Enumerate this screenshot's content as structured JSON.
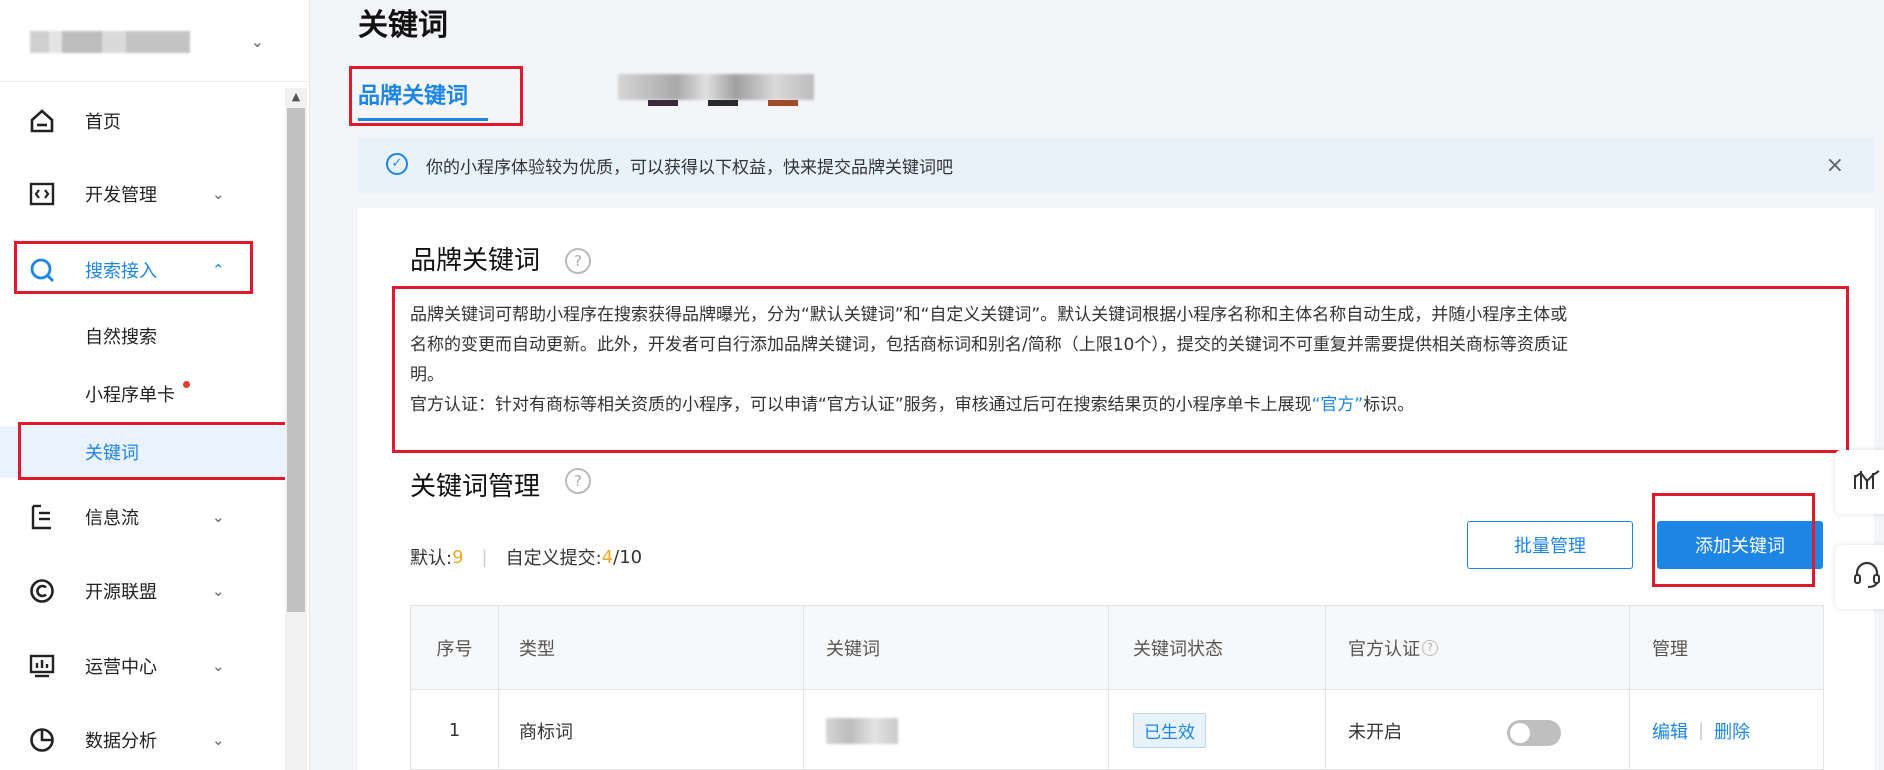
{
  "sidebar": {
    "items": [
      {
        "label": "首页",
        "icon": "home-icon"
      },
      {
        "label": "开发管理",
        "icon": "code-icon"
      },
      {
        "label": "搜索接入",
        "icon": "search-icon"
      },
      {
        "label": "信息流",
        "icon": "feed-icon"
      },
      {
        "label": "开源联盟",
        "icon": "copyright-icon"
      },
      {
        "label": "运营中心",
        "icon": "monitor-icon"
      },
      {
        "label": "数据分析",
        "icon": "pie-chart-icon"
      }
    ],
    "sub_items": [
      {
        "label": "自然搜索"
      },
      {
        "label": "小程序单卡"
      },
      {
        "label": "关键词"
      }
    ]
  },
  "page": {
    "title": "关键词",
    "tab_active": "品牌关键词"
  },
  "banner": {
    "text": "你的小程序体验较为优质，可以获得以下权益，快来提交品牌关键词吧",
    "close": "×"
  },
  "brand_section": {
    "title": "品牌关键词",
    "desc_line1": "品牌关键词可帮助小程序在搜索获得品牌曝光，分为“默认关键词”和“自定义关键词”。默认关键词根据小程序名称和主体名称自动生成，并随小程序主体或",
    "desc_line2": "名称的变更而自动更新。此外，开发者可自行添加品牌关键词，包括商标词和别名/简称（上限10个），提交的关键词不可重复并需要提供相关商标等资质证",
    "desc_line3": "明。",
    "desc_line4_prefix": "官方认证：针对有商标等相关资质的小程序，可以申请“官方认证”服务，审核通过后可在搜索结果页的小程序单卡上展现",
    "desc_line4_highlight": "“官方”",
    "desc_line4_suffix": "标识。"
  },
  "manage_section": {
    "title": "关键词管理",
    "default_label": "默认: ",
    "default_count": "9",
    "custom_label": "自定义提交: ",
    "custom_count": "4",
    "custom_total": "/10",
    "batch_button": "批量管理",
    "add_button": "添加关键词"
  },
  "table": {
    "headers": [
      "序号",
      "类型",
      "关键词",
      "关键词状态",
      "官方认证",
      "管理"
    ],
    "rows": [
      {
        "index": "1",
        "type": "商标词",
        "status": "已生效",
        "official": "未开启",
        "official_enabled": false,
        "edit": "编辑",
        "delete": "删除"
      }
    ]
  },
  "colors": {
    "accent": "#1d86e5",
    "highlight_border": "#e1192d",
    "count_orange": "#f5a623"
  }
}
